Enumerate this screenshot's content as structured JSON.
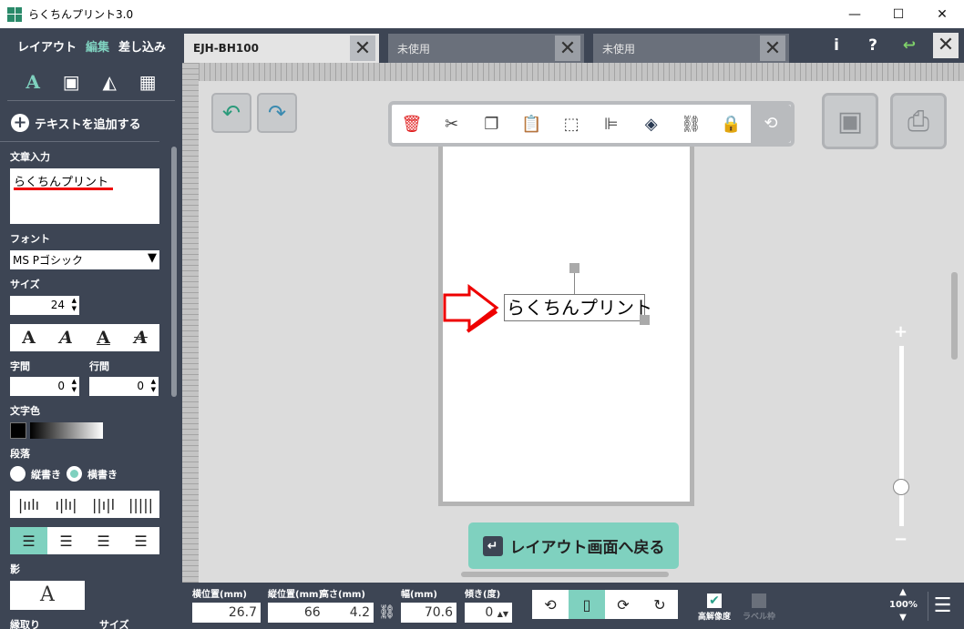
{
  "window": {
    "title": "らくちんプリント3.0",
    "minimize": "—",
    "maximize": "☐",
    "close": "✕"
  },
  "sidebar": {
    "tabs": [
      "レイアウト",
      "編集",
      "差し込み"
    ],
    "tools": [
      "A",
      "▣",
      "◭",
      "▦"
    ],
    "add_text": "テキストを追加する",
    "text_input_label": "文章入力",
    "text_input_value": "らくちんプリント",
    "font_label": "フォント",
    "font_value": "MS Pゴシック",
    "size_label": "サイズ",
    "size_value": "24",
    "style_buttons": [
      "A",
      "A",
      "A",
      "A"
    ],
    "char_spacing_label": "字間",
    "char_spacing_value": "0",
    "line_spacing_label": "行間",
    "line_spacing_value": "0",
    "color_label": "文字色",
    "paragraph_label": "段落",
    "vertical_label": "縦書き",
    "horizontal_label": "横書き",
    "shadow_label": "影",
    "outline_label": "縁取り",
    "outline_size_label": "サイズ"
  },
  "tabs": [
    {
      "label": "EJH-BH100",
      "active": true
    },
    {
      "label": "未使用",
      "active": false
    },
    {
      "label": "未使用",
      "active": false
    }
  ],
  "topright": {
    "info": "i",
    "help": "?",
    "undo": "↩"
  },
  "canvas": {
    "text_object": "らくちんプリント",
    "back_button": "レイアウト画面へ戻る"
  },
  "bottombar": {
    "x_label": "横位置(mm)",
    "x_value": "26.7",
    "y_label": "縦位置(mm)",
    "y_value": "66.2",
    "height_label": "高さ(mm)",
    "height_value": "4.2",
    "width_label": "幅(mm)",
    "width_value": "70.6",
    "angle_label": "傾き(度)",
    "angle_value": "0",
    "high_res_label": "高解像度",
    "label_frame_label": "ラベル枠",
    "zoom_value": "100%"
  },
  "colors": {
    "accent": "#7fd1bf",
    "sidebar": "#3d4554",
    "delete": "#e02020"
  }
}
